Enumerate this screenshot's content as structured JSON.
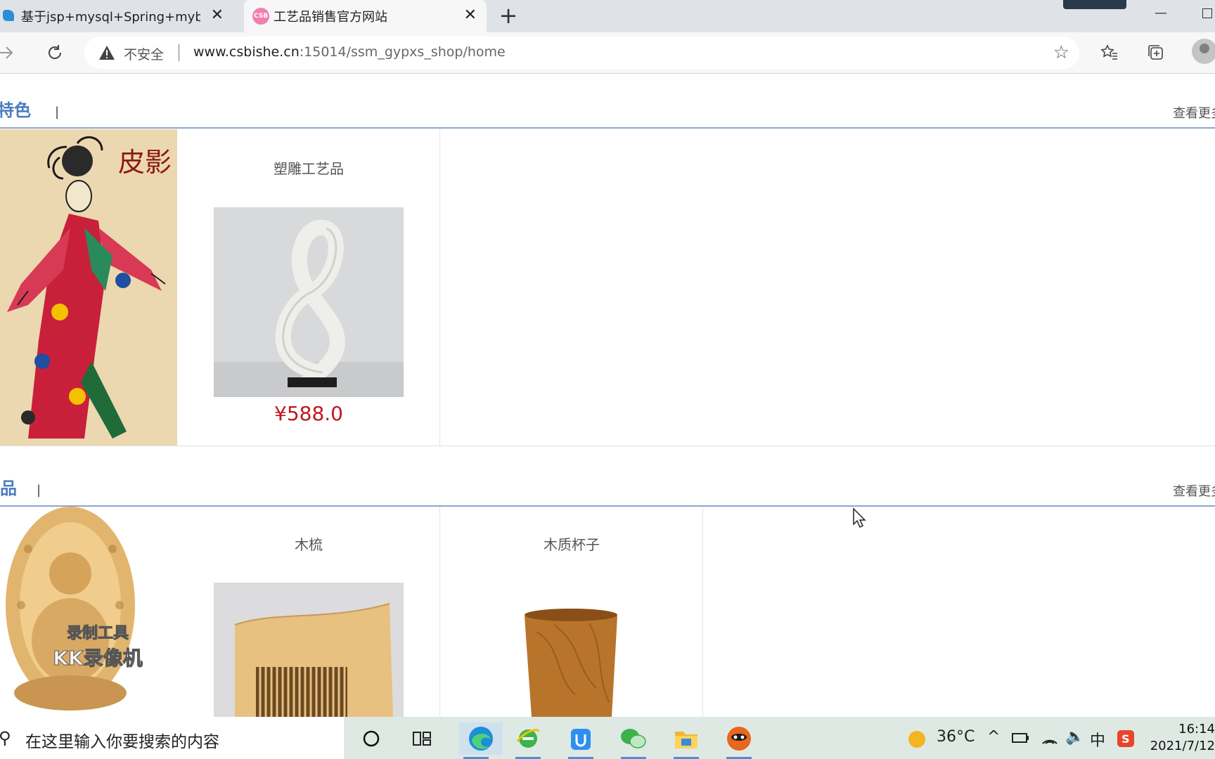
{
  "browser": {
    "tabs": [
      {
        "title": "基于jsp+mysql+Spring+mybatis的",
        "active": false
      },
      {
        "title": "工艺品销售官方网站",
        "active": true,
        "favicon_text": "CSB"
      }
    ],
    "address": {
      "security_label": "不安全",
      "host": "www.csbishe.cn",
      "path": ":15014/ssm_gypxs_shop/home"
    }
  },
  "sections": [
    {
      "title": "特色",
      "divider": "|",
      "more_label": "查看更多",
      "products": [
        {
          "name": "塑雕工艺品",
          "price": "¥588.0"
        }
      ]
    },
    {
      "title": "品",
      "divider": "|",
      "more_label": "查看更多",
      "products": [
        {
          "name": "木梳",
          "price": ""
        },
        {
          "name": "木质杯子",
          "price": ""
        }
      ]
    }
  ],
  "watermark": {
    "line1": "录制工具",
    "line2": "KK录像机"
  },
  "banner_art_text": "皮影",
  "taskbar": {
    "search_placeholder": "在这里输入你要搜索的内容",
    "weather": "36°C",
    "ime": "中",
    "time": "16:14",
    "date": "2021/7/12"
  },
  "colors": {
    "accent": "#4a7cc0",
    "price": "#c0161e",
    "divider": "#8aa6c9"
  }
}
